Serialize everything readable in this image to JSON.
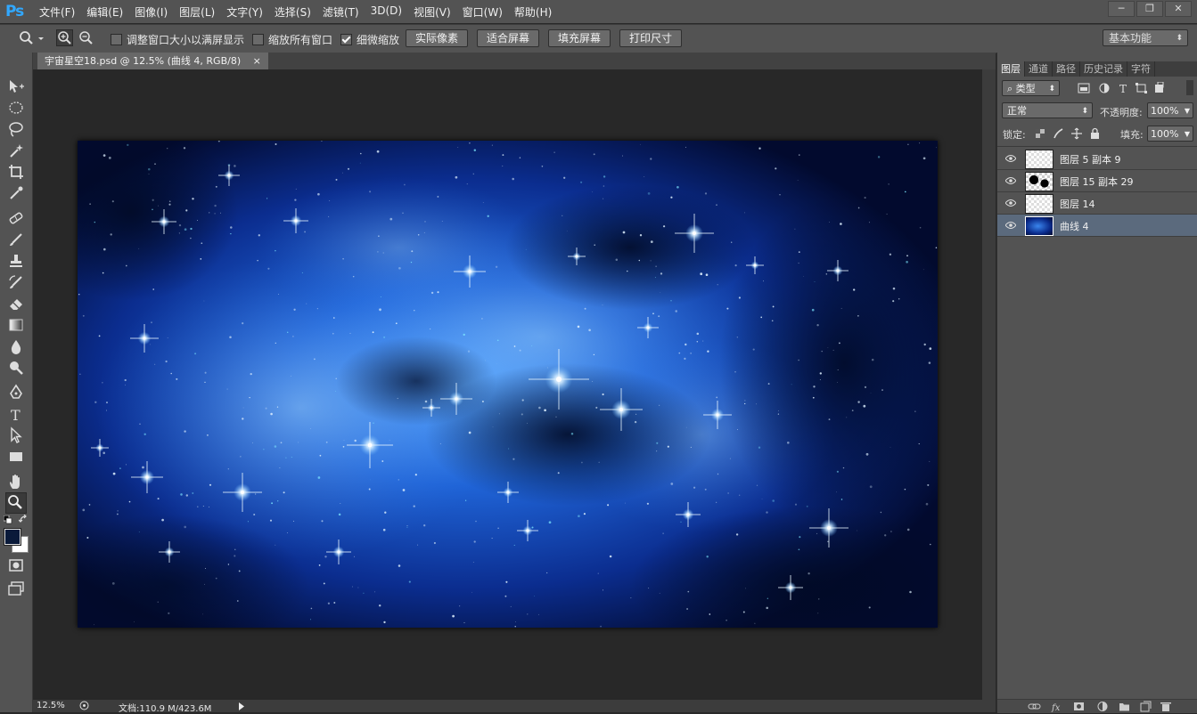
{
  "app": {
    "logo": "Ps",
    "menu": [
      "文件(F)",
      "编辑(E)",
      "图像(I)",
      "图层(L)",
      "文字(Y)",
      "选择(S)",
      "滤镜(T)",
      "3D(D)",
      "视图(V)",
      "窗口(W)",
      "帮助(H)"
    ],
    "window_controls": [
      "─",
      "❐",
      "✕"
    ]
  },
  "options": {
    "resize_window_label": "调整窗口大小以满屏显示",
    "resize_window_checked": false,
    "zoom_all_label": "缩放所有窗口",
    "zoom_all_checked": false,
    "scrubby_zoom_label": "细微缩放",
    "scrubby_zoom_checked": true,
    "btn_actual_pixels": "实际像素",
    "btn_fit_screen": "适合屏幕",
    "btn_fill_screen": "填充屏幕",
    "btn_print_size": "打印尺寸",
    "workspace": "基本功能"
  },
  "document": {
    "tab_title": "宇宙星空18.psd @ 12.5% (曲线 4, RGB/8)",
    "tab_close": "×",
    "zoom": "12.5%",
    "doc_size": "文档:110.9 M/423.6M"
  },
  "panel": {
    "tabs": [
      "图层",
      "通道",
      "路径",
      "历史记录",
      "字符"
    ],
    "active_tab": "图层",
    "filter_kind": "类型",
    "blend_mode": "正常",
    "opacity_label": "不透明度:",
    "opacity_value": "100%",
    "lock_label": "锁定:",
    "fill_label": "填充:",
    "fill_value": "100%",
    "layers": [
      {
        "name": "图层 5 副本 9",
        "selected": false
      },
      {
        "name": "图层 15 副本 29",
        "selected": false
      },
      {
        "name": "图层 14",
        "selected": false
      },
      {
        "name": "曲线 4",
        "selected": true
      }
    ],
    "bottom_icons": [
      "link-icon",
      "fx-icon",
      "mask-icon",
      "adjustment-icon",
      "group-folder-icon",
      "new-layer-icon",
      "trash-icon"
    ]
  },
  "colors": {
    "foreground": "#0a1a3a",
    "background": "#ffffff",
    "accent": "#31a8ff"
  }
}
